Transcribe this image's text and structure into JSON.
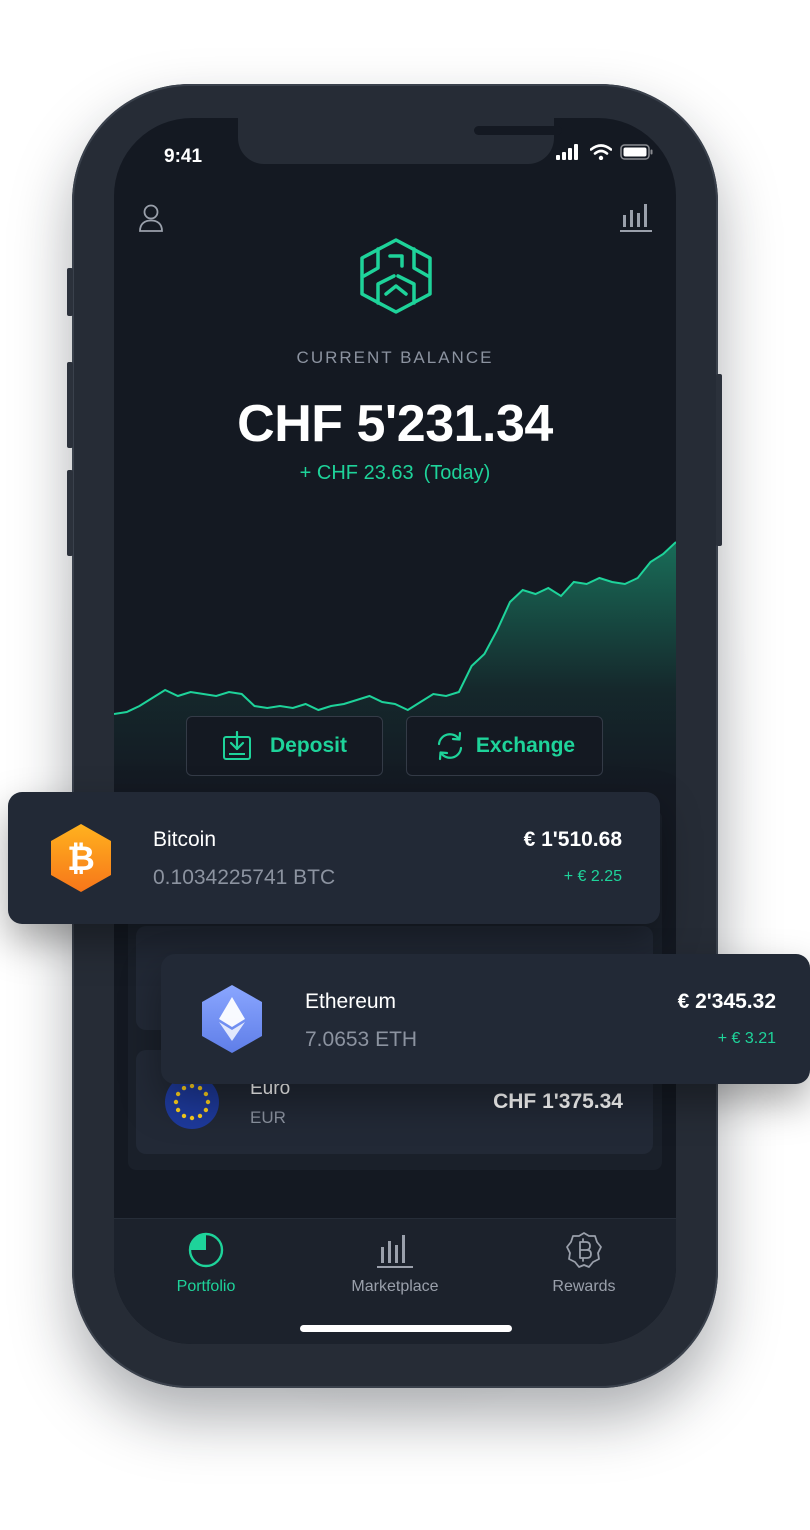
{
  "status_bar": {
    "time": "9:41"
  },
  "header": {
    "balance_label": "CURRENT BALANCE",
    "balance_value": "CHF 5'231.34",
    "balance_change": "+ CHF 23.63",
    "balance_change_period": "(Today)"
  },
  "actions": {
    "deposit_label": "Deposit",
    "exchange_label": "Exchange"
  },
  "assets": [
    {
      "name": "Bitcoin",
      "amount": "0.1034225741 BTC",
      "value": "€ 1'510.68",
      "change": "+ € 2.25",
      "icon": "bitcoin-icon"
    },
    {
      "name": "Ethereum",
      "amount": "7.0653 ETH",
      "value": "€ 2'345.32",
      "change": "+ € 3.21",
      "icon": "ethereum-icon"
    },
    {
      "name": "Euro",
      "amount": "EUR",
      "value": "CHF 1'375.34",
      "change": "",
      "icon": "eu-flag-icon"
    }
  ],
  "nav": {
    "items": [
      {
        "label": "Portfolio",
        "icon": "portfolio-pie-icon",
        "active": true
      },
      {
        "label": "Marketplace",
        "icon": "bar-chart-icon",
        "active": false
      },
      {
        "label": "Rewards",
        "icon": "bitcoin-badge-icon",
        "active": false
      }
    ]
  },
  "colors": {
    "accent": "#1ed39a",
    "background": "#141922",
    "card": "#222936",
    "bitcoin": "#f7931a",
    "ethereum": "#6f8ff7",
    "eu_blue": "#1e3a9c"
  },
  "chart_data": {
    "type": "area",
    "y": [
      32,
      33,
      36,
      40,
      44,
      41,
      43,
      42,
      41,
      43,
      42,
      36,
      35,
      36,
      35,
      37,
      34,
      36,
      37,
      39,
      41,
      38,
      37,
      34,
      38,
      42,
      41,
      43,
      56,
      62,
      74,
      88,
      94,
      92,
      95,
      91,
      98,
      97,
      100,
      98,
      97,
      100,
      108,
      112,
      118
    ]
  }
}
